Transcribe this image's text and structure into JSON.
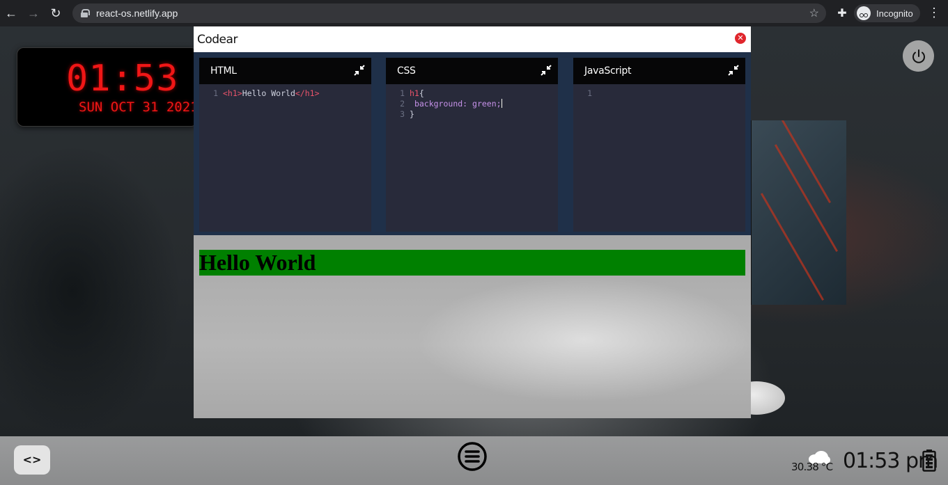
{
  "browser": {
    "url": "react-os.netlify.app",
    "incognito_label": "Incognito",
    "icons": [
      "back-arrow-icon",
      "forward-arrow-icon",
      "reload-icon",
      "lock-icon",
      "star-icon",
      "extensions-icon",
      "incognito-icon",
      "kebab-menu-icon"
    ]
  },
  "desktop": {
    "clock": {
      "time": "01:53 PM",
      "date": "SUN OCT 31 2021",
      "color": "#f01616"
    }
  },
  "codear": {
    "title": "Codear",
    "editors": [
      {
        "label": "HTML",
        "lines": [
          {
            "num": "1",
            "text": "<h1>Hello World</h1>"
          }
        ]
      },
      {
        "label": "CSS",
        "lines": [
          {
            "num": "1",
            "text": "h1{"
          },
          {
            "num": "2",
            "text": "    background: green;"
          },
          {
            "num": "3",
            "text": "}"
          }
        ]
      },
      {
        "label": "JavaScript",
        "lines": [
          {
            "num": "1",
            "text": ""
          }
        ]
      }
    ],
    "preview": {
      "h1_text": "Hello World",
      "h1_background": "#008000"
    }
  },
  "taskbar": {
    "code_button_label": "<>",
    "temperature": "30.38 °C",
    "time": "01:53 pm"
  },
  "colors": {
    "window_body": "#1e2a3b",
    "editor_bg": "#282a3a",
    "editor_header": "#060607",
    "close_button": "#e0262c",
    "taskbar": "#9a9b9c"
  }
}
